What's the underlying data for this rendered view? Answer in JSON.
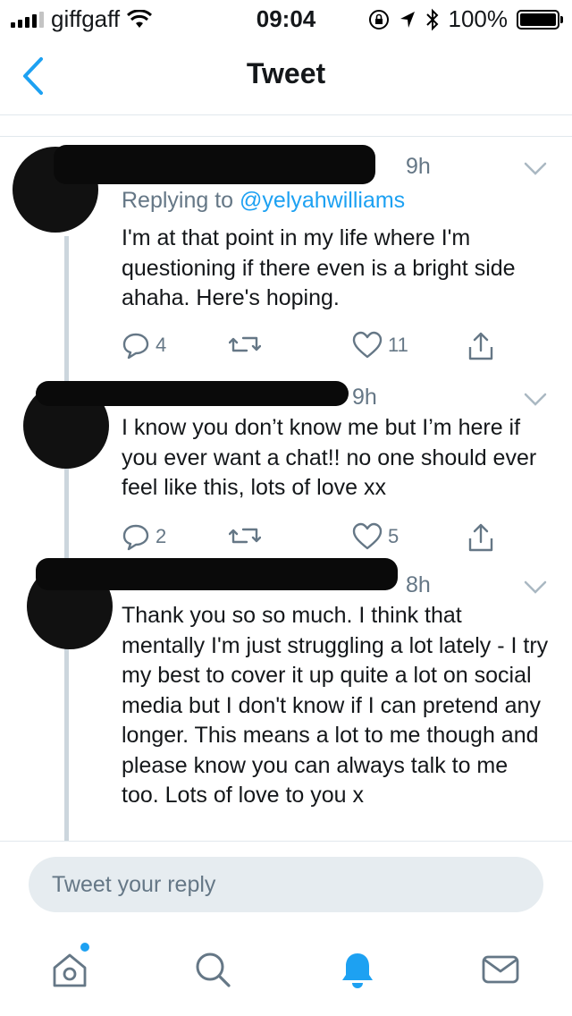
{
  "status": {
    "carrier": "giffgaff",
    "time": "09:04",
    "battery": "100%",
    "battery_level": 1.0
  },
  "nav": {
    "title": "Tweet"
  },
  "tweets": [
    {
      "time": "9h",
      "replying_prefix": "Replying to ",
      "replying_handle": "@yelyahwilliams",
      "text": "I'm at that point in my life where I'm questioning if there even is a bright side ahaha. Here's hoping.",
      "replies": "4",
      "retweets": "",
      "likes": "11"
    },
    {
      "time": "9h",
      "text": "I know you don’t know me but I’m here if you ever want a chat!! no one should ever feel like this, lots of love xx",
      "replies": "2",
      "retweets": "",
      "likes": "5"
    },
    {
      "time": "8h",
      "text": "Thank you so so much. I think that mentally I'm just struggling a lot lately - I try my best to cover it up quite a lot on social media but I don't know if I can pretend any longer. This means a lot to me though and please know you can always talk to me too. Lots of love to you x"
    }
  ],
  "reply": {
    "placeholder": "Tweet your reply"
  },
  "tabs": [
    "home-icon",
    "search-icon",
    "notifications-icon",
    "messages-icon"
  ],
  "colors": {
    "accent": "#1da1f2",
    "muted": "#657786",
    "text": "#14171a",
    "input_bg": "#e6ecf0"
  }
}
